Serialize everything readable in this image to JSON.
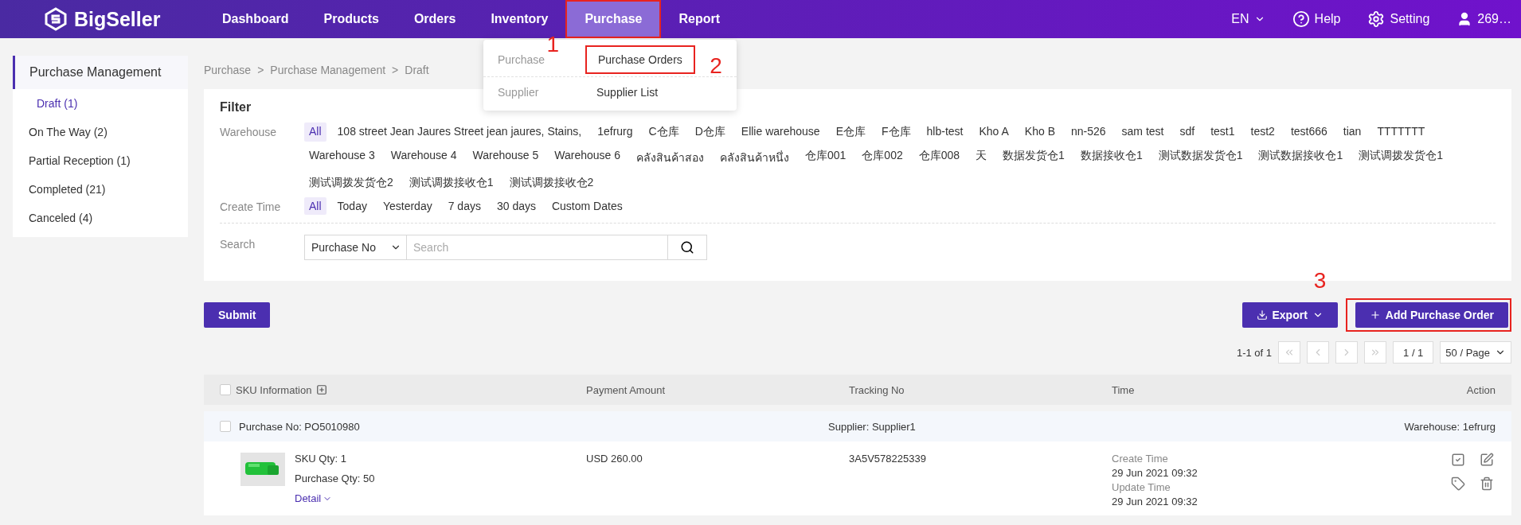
{
  "nav": {
    "logo": "BigSeller",
    "items": [
      {
        "label": "Dashboard",
        "selected": false
      },
      {
        "label": "Products",
        "selected": false
      },
      {
        "label": "Orders",
        "selected": false
      },
      {
        "label": "Inventory",
        "selected": false
      },
      {
        "label": "Purchase",
        "selected": true,
        "callout": "1"
      },
      {
        "label": "Report",
        "selected": false
      }
    ],
    "language": "EN",
    "help": "Help",
    "setting": "Setting",
    "user": "269…"
  },
  "dropdown": {
    "groups": [
      {
        "label": "Purchase",
        "items": [
          {
            "label": "Purchase Orders",
            "callout": "2"
          }
        ]
      },
      {
        "label": "Supplier",
        "items": [
          {
            "label": "Supplier List"
          }
        ]
      }
    ]
  },
  "sidebar": {
    "title": "Purchase Management",
    "items": [
      {
        "label": "Draft",
        "count": "(1)",
        "selected": true
      },
      {
        "label": "On The Way",
        "count": "(2)",
        "selected": false
      },
      {
        "label": "Partial Reception",
        "count": "(1)",
        "selected": false
      },
      {
        "label": "Completed",
        "count": "(21)",
        "selected": false
      },
      {
        "label": "Canceled",
        "count": "(4)",
        "selected": false
      }
    ]
  },
  "breadcrumb": {
    "separator": ">",
    "items": [
      "Purchase",
      "Purchase Management",
      "Draft"
    ]
  },
  "filter": {
    "title": "Filter",
    "rows": [
      {
        "label": "Warehouse",
        "options": [
          {
            "label": "All",
            "selected": true
          },
          {
            "label": "108 street Jean Jaures Street jean jaures, Stains,",
            "selected": false
          },
          {
            "label": "1efrurg",
            "selected": false
          },
          {
            "label": "C仓库",
            "selected": false
          },
          {
            "label": "D仓库",
            "selected": false
          },
          {
            "label": "Ellie warehouse",
            "selected": false
          },
          {
            "label": "E仓库",
            "selected": false
          },
          {
            "label": "F仓库",
            "selected": false
          },
          {
            "label": "hlb-test",
            "selected": false
          },
          {
            "label": "Kho A",
            "selected": false
          },
          {
            "label": "Kho B",
            "selected": false
          },
          {
            "label": "nn-526",
            "selected": false
          },
          {
            "label": "sam test",
            "selected": false
          },
          {
            "label": "sdf",
            "selected": false
          },
          {
            "label": "test1",
            "selected": false
          },
          {
            "label": "test2",
            "selected": false
          },
          {
            "label": "test666",
            "selected": false
          },
          {
            "label": "tian",
            "selected": false
          },
          {
            "label": "TTTTTTT",
            "selected": false
          },
          {
            "label": "Warehouse 3",
            "selected": false
          },
          {
            "label": "Warehouse 4",
            "selected": false
          },
          {
            "label": "Warehouse 5",
            "selected": false
          },
          {
            "label": "Warehouse 6",
            "selected": false
          },
          {
            "label": "คลังสินค้าสอง",
            "selected": false
          },
          {
            "label": "คลังสินค้าหนึ่ง",
            "selected": false
          },
          {
            "label": "仓库001",
            "selected": false
          },
          {
            "label": "仓库002",
            "selected": false
          },
          {
            "label": "仓库008",
            "selected": false
          },
          {
            "label": "天",
            "selected": false
          },
          {
            "label": "数据发货仓1",
            "selected": false
          },
          {
            "label": "数据接收仓1",
            "selected": false
          },
          {
            "label": "测试数据发货仓1",
            "selected": false
          },
          {
            "label": "测试数据接收仓1",
            "selected": false
          },
          {
            "label": "测试调拨发货仓1",
            "selected": false
          },
          {
            "label": "测试调拨发货仓2",
            "selected": false
          },
          {
            "label": "测试调拨接收仓1",
            "selected": false
          },
          {
            "label": "测试调拨接收仓2",
            "selected": false
          }
        ]
      },
      {
        "label": "Create Time",
        "options": [
          {
            "label": "All",
            "selected": true
          },
          {
            "label": "Today",
            "selected": false
          },
          {
            "label": "Yesterday",
            "selected": false
          },
          {
            "label": "7 days",
            "selected": false
          },
          {
            "label": "30 days",
            "selected": false
          },
          {
            "label": "Custom Dates",
            "selected": false
          }
        ]
      }
    ],
    "search": {
      "label": "Search",
      "type": "Purchase No",
      "placeholder": "Search"
    }
  },
  "actions": {
    "submit": "Submit",
    "export": "Export",
    "add": {
      "label": "Add Purchase Order",
      "callout": "3"
    }
  },
  "pagination": {
    "range": "1-1 of 1",
    "buttons": [
      {
        "kind": "first",
        "disabled": true
      },
      {
        "kind": "prev",
        "disabled": true
      },
      {
        "kind": "next",
        "disabled": true
      },
      {
        "kind": "last",
        "disabled": true
      }
    ],
    "page": "1 / 1",
    "page_size": "50 / Page"
  },
  "table": {
    "header_checked": false,
    "columns": [
      "SKU Information",
      "Payment Amount",
      "Tracking No",
      "Time",
      "Action"
    ],
    "orders": [
      {
        "checked": false,
        "purchase_no": "Purchase No: PO5010980",
        "supplier": "Supplier: Supplier1",
        "warehouse": "Warehouse: 1efrurg",
        "sku_qty": "SKU Qty: 1",
        "purchase_qty": "Purchase Qty: 50",
        "detail": "Detail",
        "payment": "USD 260.00",
        "tracking": "3A5V578225339",
        "times": [
          {
            "label": "Create Time",
            "value": "29 Jun 2021 09:32"
          },
          {
            "label": "Update Time",
            "value": "29 Jun 2021 09:32"
          }
        ]
      }
    ]
  }
}
